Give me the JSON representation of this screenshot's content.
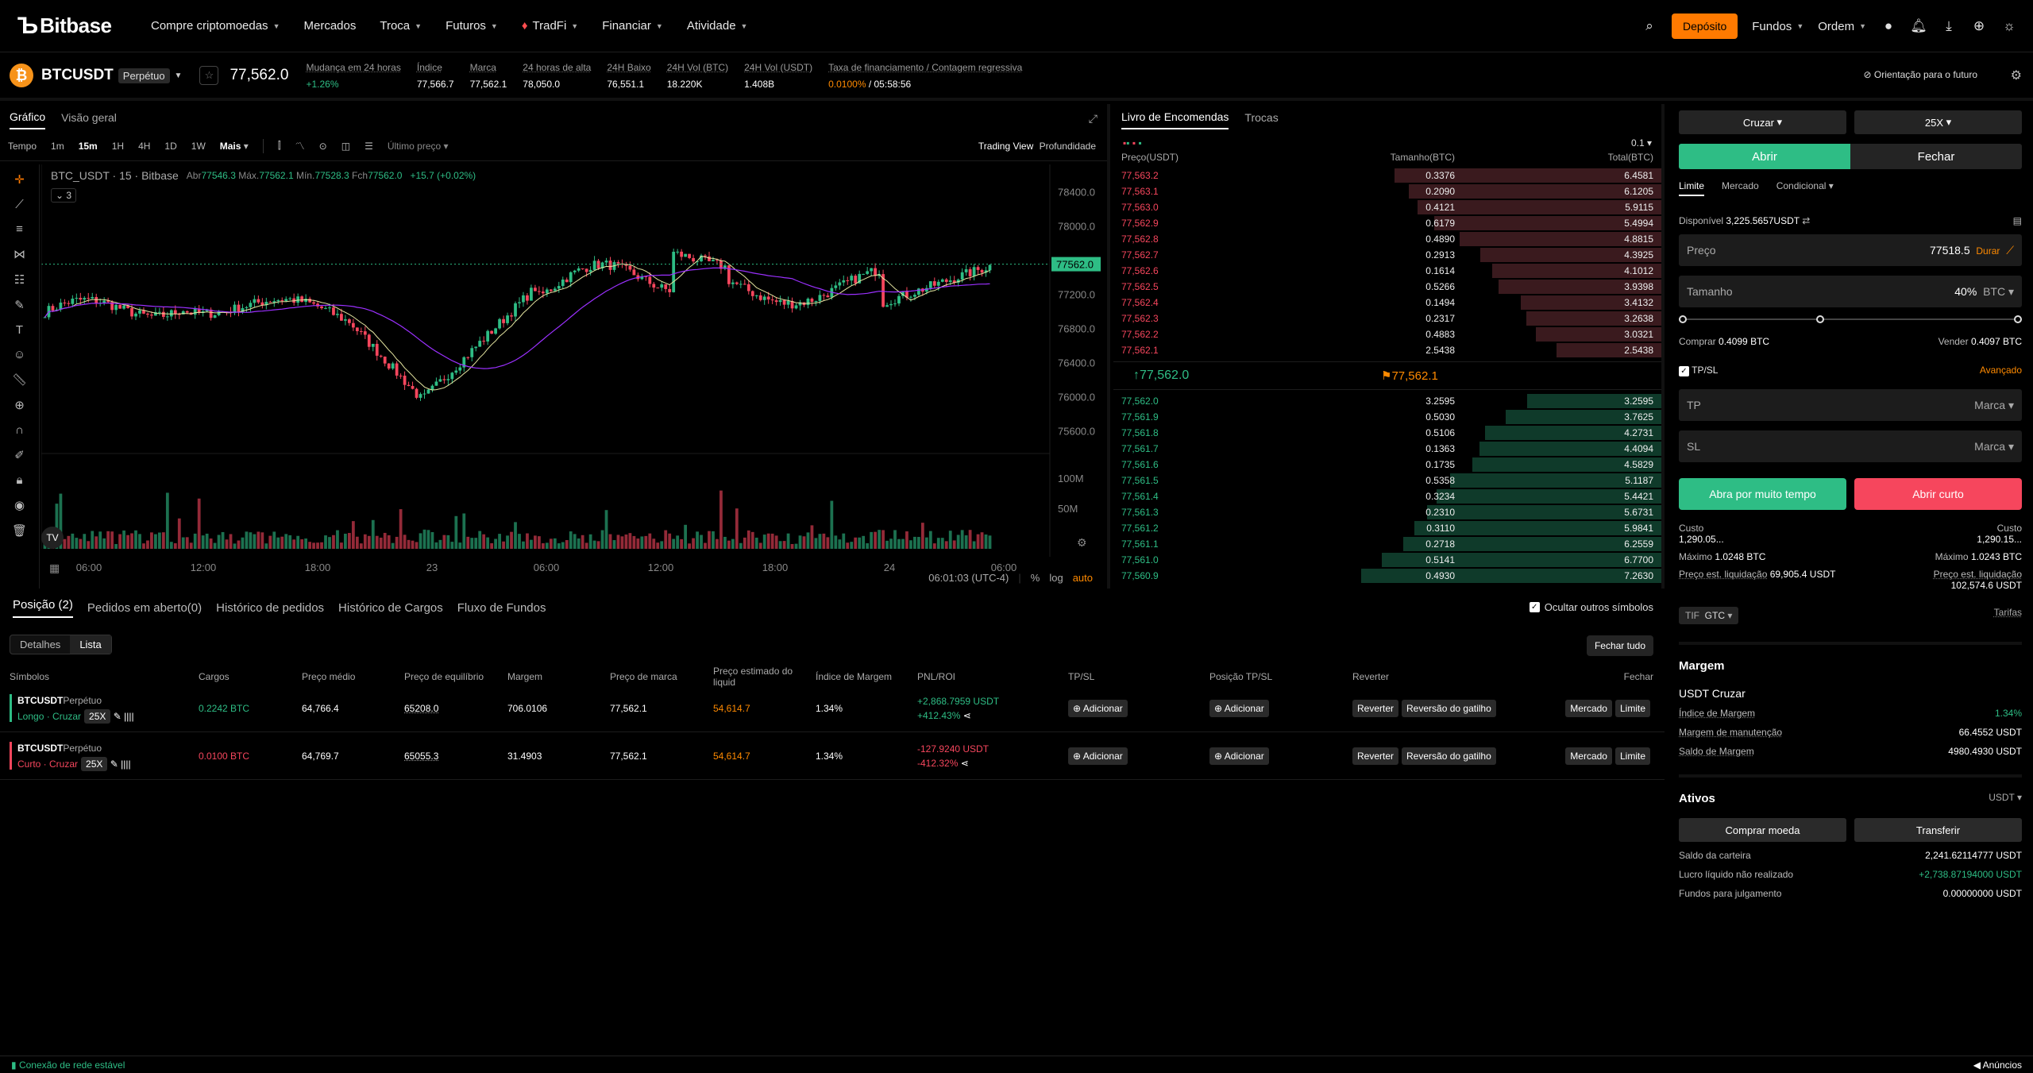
{
  "brand": {
    "logo": "Bitbase"
  },
  "nav": {
    "items": [
      {
        "label": "Compre criptomoedas",
        "chev": true
      },
      {
        "label": "Mercados",
        "chev": false
      },
      {
        "label": "Troca",
        "chev": true
      },
      {
        "label": "Futuros",
        "chev": true
      },
      {
        "label": "TradFi",
        "chev": true
      },
      {
        "label": "Financiar",
        "chev": true
      },
      {
        "label": "Atividade",
        "chev": true
      }
    ],
    "deposit": "Depósito",
    "funds": "Fundos",
    "order": "Ordem"
  },
  "ticker": {
    "symbol": "BTCUSDT",
    "type": "Perpétuo",
    "last": "77,562.0",
    "stats": [
      {
        "label": "Mudança em 24 horas",
        "value": "+1.26%",
        "color": "green"
      },
      {
        "label": "Índice",
        "value": "77,566.7"
      },
      {
        "label": "Marca",
        "value": "77,562.1"
      },
      {
        "label": "24 horas de alta",
        "value": "78,050.0"
      },
      {
        "label": "24H Baixo",
        "value": "76,551.1"
      },
      {
        "label": "24H Vol (BTC)",
        "value": "18.220K"
      },
      {
        "label": "24H Vol (USDT)",
        "value": "1.408B"
      }
    ],
    "funding_label": "Taxa de financiamento / Contagem regressiva",
    "funding_rate": "0.0100%",
    "countdown": "/ 05:58:56",
    "guide": "Orientação para o futuro"
  },
  "chart": {
    "tabs": [
      "Gráfico",
      "Visão geral"
    ],
    "toolbar": {
      "time": "Tempo",
      "intervals": [
        "1m",
        "15m",
        "1H",
        "4H",
        "1D",
        "1W"
      ],
      "selected": "15m",
      "more": "Mais",
      "price_type": "Último preço",
      "trading_view": "Trading View",
      "depth": "Profundidade"
    },
    "legend": {
      "title": "BTC_USDT · 15 · Bitbase",
      "ohlc": [
        [
          "Abr",
          "77546.3"
        ],
        [
          "Máx.",
          "77562.1"
        ],
        [
          "Mín.",
          "77528.3"
        ],
        [
          "Fch",
          "77562.0"
        ]
      ],
      "change": "+15.7 (+0.02%)",
      "indicators": "3"
    },
    "price_label": "77562.0",
    "y_ticks": [
      "78400.0",
      "78000.0",
      "77200.0",
      "76800.0",
      "76400.0",
      "76000.0",
      "75600.0"
    ],
    "vol_ticks": [
      "100M",
      "50M"
    ],
    "x_ticks": [
      "06:00",
      "12:00",
      "18:00",
      "23",
      "06:00",
      "12:00",
      "18:00",
      "24",
      "06:00"
    ],
    "clock": "06:01:03 (UTC-4)",
    "pct": "%",
    "log": "log",
    "auto": "auto"
  },
  "orderbook": {
    "tabs": [
      "Livro de Encomendas",
      "Trocas"
    ],
    "precision": "0.1",
    "headers": [
      "Preço(USDT)",
      "Tamanho(BTC)",
      "Total(BTC)"
    ],
    "asks": [
      [
        "77,563.2",
        "0.3376",
        "6.4581"
      ],
      [
        "77,563.1",
        "0.2090",
        "6.1205"
      ],
      [
        "77,563.0",
        "0.4121",
        "5.9115"
      ],
      [
        "77,562.9",
        "0.6179",
        "5.4994"
      ],
      [
        "77,562.8",
        "0.4890",
        "4.8815"
      ],
      [
        "77,562.7",
        "0.2913",
        "4.3925"
      ],
      [
        "77,562.6",
        "0.1614",
        "4.1012"
      ],
      [
        "77,562.5",
        "0.5266",
        "3.9398"
      ],
      [
        "77,562.4",
        "0.1494",
        "3.4132"
      ],
      [
        "77,562.3",
        "0.2317",
        "3.2638"
      ],
      [
        "77,562.2",
        "0.4883",
        "3.0321"
      ],
      [
        "77,562.1",
        "2.5438",
        "2.5438"
      ]
    ],
    "mid": "↑77,562.0",
    "mark": "77,562.1",
    "bids": [
      [
        "77,562.0",
        "3.2595",
        "3.2595"
      ],
      [
        "77,561.9",
        "0.5030",
        "3.7625"
      ],
      [
        "77,561.8",
        "0.5106",
        "4.2731"
      ],
      [
        "77,561.7",
        "0.1363",
        "4.4094"
      ],
      [
        "77,561.6",
        "0.1735",
        "4.5829"
      ],
      [
        "77,561.5",
        "0.5358",
        "5.1187"
      ],
      [
        "77,561.4",
        "0.3234",
        "5.4421"
      ],
      [
        "77,561.3",
        "0.2310",
        "5.6731"
      ],
      [
        "77,561.2",
        "0.3110",
        "5.9841"
      ],
      [
        "77,561.1",
        "0.2718",
        "6.2559"
      ],
      [
        "77,561.0",
        "0.5141",
        "6.7700"
      ],
      [
        "77,560.9",
        "0.4930",
        "7.2630"
      ]
    ]
  },
  "trade": {
    "margin_mode": "Cruzar",
    "leverage": "25X",
    "open": "Abrir",
    "close": "Fechar",
    "order_tabs": [
      "Limite",
      "Mercado",
      "Condicional"
    ],
    "available_label": "Disponível",
    "available": "3,225.5657USDT",
    "price_label": "Preço",
    "price": "77518.5",
    "price_mode": "Durar",
    "size_label": "Tamanho",
    "size": "40%",
    "size_unit": "BTC",
    "buy": "Comprar",
    "buy_val": "0.4099 BTC",
    "sell": "Vender",
    "sell_val": "0.4097 BTC",
    "tpsl": "TP/SL",
    "advanced": "Avançado",
    "tp": "TP",
    "sl": "SL",
    "marca": "Marca",
    "long": "Abra por muito tempo",
    "short": "Abrir curto",
    "cost_label": "Custo",
    "cost_l": "1,290.05...",
    "cost_r": "1,290.15...",
    "max_label": "Máximo",
    "max_l": "1.0248 BTC",
    "max_r": "1.0243 BTC",
    "liq_label": "Preço est. liquidação",
    "liq_l": "69,905.4 USDT",
    "liq_r": "102,574.6 USDT",
    "tif": "TIF",
    "gtc": "GTC",
    "fees": "Tarifas"
  },
  "margin": {
    "title": "Margem",
    "mode": "USDT Cruzar",
    "rows": [
      [
        "Índice de Margem",
        "1.34%"
      ],
      [
        "Margem de manutenção",
        "66.4552 USDT"
      ],
      [
        "Saldo de Margem",
        "4980.4930 USDT"
      ]
    ]
  },
  "assets": {
    "title": "Ativos",
    "unit": "USDT",
    "buy": "Comprar moeda",
    "transfer": "Transferir",
    "rows": [
      [
        "Saldo da carteira",
        "2,241.62114777 USDT"
      ],
      [
        "Lucro líquido não realizado",
        "+2,738.87194000 USDT"
      ],
      [
        "Fundos para julgamento",
        "0.00000000 USDT"
      ]
    ]
  },
  "positions": {
    "tabs": [
      "Posição (2)",
      "Pedidos em aberto(0)",
      "Histórico de pedidos",
      "Histórico de Cargos",
      "Fluxo de Fundos"
    ],
    "hide_others": "Ocultar outros símbolos",
    "views": [
      "Detalhes",
      "Lista"
    ],
    "close_all": "Fechar tudo",
    "headers": [
      "Símbolos",
      "Cargos",
      "Preço médio",
      "Preço de equilíbrio",
      "Margem",
      "Preço de marca",
      "Preço estimado do liquid",
      "Índice de Margem",
      "PNL/ROI",
      "TP/SL",
      "Posição TP/SL",
      "Reverter",
      "Fechar"
    ],
    "rows": [
      {
        "symbol": "BTCUSDT",
        "type": "Perpétuo",
        "side": "Longo · Cruzar",
        "lev": "25X",
        "qty": "0.2242 BTC",
        "avg": "64,766.4",
        "be": "65208.0",
        "margin": "706.0106",
        "mark": "77,562.1",
        "liq": "54,614.7",
        "mr": "1.34%",
        "pnl": "+2,868.7959 USDT",
        "roi": "+412.43%",
        "color": "green"
      },
      {
        "symbol": "BTCUSDT",
        "type": "Perpétuo",
        "side": "Curto · Cruzar",
        "lev": "25X",
        "qty": "0.0100 BTC",
        "avg": "64,769.7",
        "be": "65055.3",
        "margin": "31.4903",
        "mark": "77,562.1",
        "liq": "54,614.7",
        "mr": "1.34%",
        "pnl": "-127.9240 USDT",
        "roi": "-412.32%",
        "color": "red"
      }
    ],
    "btn_add": "Adicionar",
    "btn_reverse": "Reverter",
    "btn_trigger": "Reversão do gatilho",
    "btn_market": "Mercado",
    "btn_limit": "Limite"
  },
  "status": {
    "connection": "Conexão de rede estável",
    "ann": "Anúncios"
  }
}
